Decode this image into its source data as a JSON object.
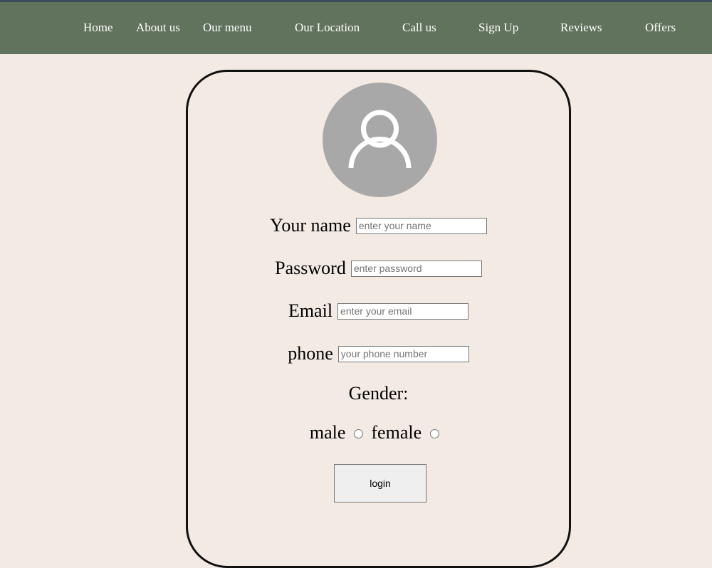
{
  "nav": {
    "items": [
      {
        "label": "Home"
      },
      {
        "label": "About us"
      },
      {
        "label": "Our menu"
      },
      {
        "label": "Our Location"
      },
      {
        "label": "Call us"
      },
      {
        "label": "Sign Up"
      },
      {
        "label": "Reviews"
      },
      {
        "label": "Offers"
      }
    ]
  },
  "avatar": {
    "icon": "user-icon"
  },
  "form": {
    "name": {
      "label": "Your name",
      "placeholder": "enter your name",
      "value": ""
    },
    "password": {
      "label": "Password",
      "placeholder": "enter password",
      "value": ""
    },
    "email": {
      "label": "Email",
      "placeholder": "enter your email",
      "value": ""
    },
    "phone": {
      "label": "phone",
      "placeholder": "your phone number",
      "value": ""
    },
    "gender": {
      "label": "Gender:",
      "options": [
        {
          "label": "male",
          "checked": false
        },
        {
          "label": "female",
          "checked": false
        }
      ]
    },
    "login_label": "login"
  },
  "colors": {
    "background": "#f3ebe3",
    "navbar": "#61725d",
    "avatar": "#a8a8a8",
    "button": "#efefef"
  }
}
